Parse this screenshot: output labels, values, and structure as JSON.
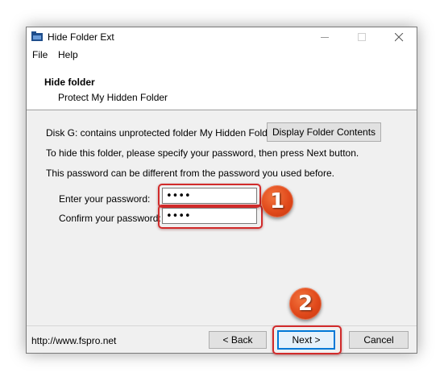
{
  "window": {
    "title": "Hide Folder Ext",
    "icon": "folder-icon"
  },
  "menu": {
    "items": [
      "File",
      "Help"
    ]
  },
  "header": {
    "title": "Hide folder",
    "subtitle": "Protect My Hidden Folder"
  },
  "body": {
    "disk_info": "Disk G: contains unprotected folder My Hidden Folder",
    "display_button": "Display Folder Contents",
    "instruction": "To hide this folder, please specify your password, then press Next button.",
    "note": "This password can be different from the password you used before."
  },
  "form": {
    "password_label": "Enter your password:",
    "password_value": "••••",
    "confirm_label": "Confirm your password:",
    "confirm_value": "••••"
  },
  "footer": {
    "website": "http://www.fspro.net",
    "back_button": "< Back",
    "next_button": "Next >",
    "cancel_button": "Cancel"
  },
  "annotations": {
    "callout_1": "1",
    "callout_2": "2",
    "highlight_color": "#d12a2a",
    "callout_color": "#e0481a"
  }
}
